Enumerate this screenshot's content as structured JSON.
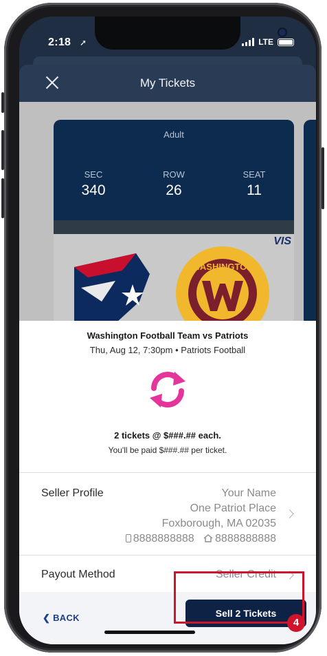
{
  "status_bar": {
    "time": "2:18",
    "network": "LTE"
  },
  "header": {
    "title": "My Tickets"
  },
  "ticket": {
    "type": "Adult",
    "sec_label": "SEC",
    "sec_value": "340",
    "row_label": "ROW",
    "row_value": "26",
    "seat_label": "SEAT",
    "seat_value": "11",
    "sponsor": "VIS",
    "team_logo_text": "WASHINGTON"
  },
  "event": {
    "title": "Washington Football Team vs Patriots",
    "subtitle": "Thu, Aug 12, 7:30pm • Patriots Football"
  },
  "pricing": {
    "tickets_line": "2 tickets @ $###.## each.",
    "paid_line": "You'll be paid $###.## per ticket."
  },
  "seller_profile": {
    "label": "Seller Profile",
    "name": "Your Name",
    "address_line1": "One Patriot Place",
    "address_line2": "Foxborough, MA 02035",
    "mobile": "8888888888",
    "home": "8888888888"
  },
  "payout": {
    "label": "Payout Method",
    "value": "Seller Credit"
  },
  "footer": {
    "back_label": "BACK",
    "sell_label": "Sell 2 Tickets"
  },
  "callout": {
    "step": "4",
    "color": "#d0142c"
  },
  "icons": [
    "location-arrow-icon",
    "signal-icon",
    "battery-icon",
    "close-icon",
    "swap-arrows-icon",
    "chevron-right-icon",
    "mobile-phone-icon",
    "home-icon",
    "chevron-left-icon"
  ]
}
